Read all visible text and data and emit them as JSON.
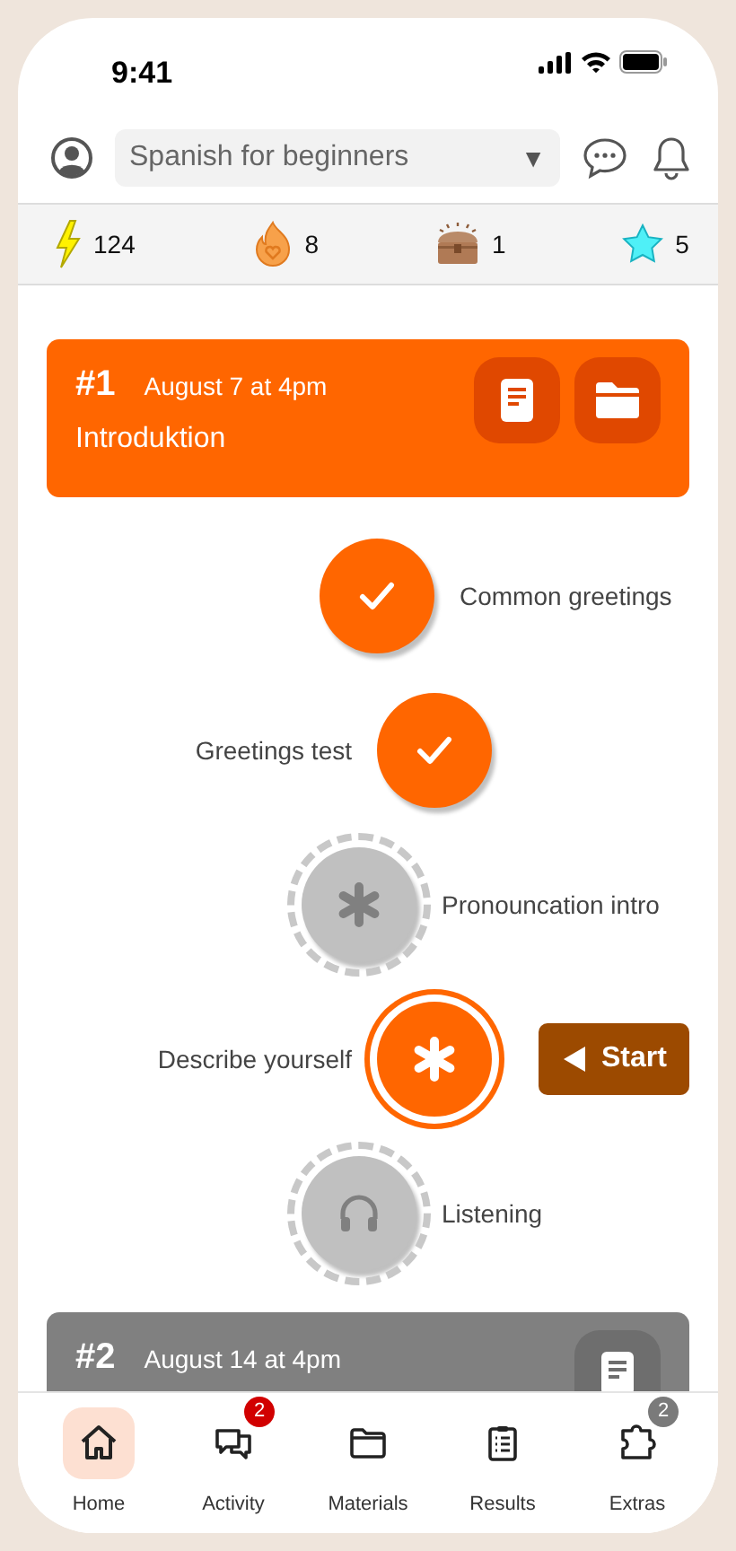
{
  "status_bar": {
    "time": "9:41"
  },
  "header": {
    "course_select": {
      "value": "Spanish for beginners",
      "caret": "▼"
    }
  },
  "stats": [
    {
      "value": "124"
    },
    {
      "value": "8"
    },
    {
      "value": "1"
    },
    {
      "value": "5"
    }
  ],
  "sessions": [
    {
      "number": "#1",
      "date": "August 7 at 4pm",
      "title": "Introduktion",
      "selected": true,
      "lessons": [
        {
          "label": "Common greetings",
          "kind": "check",
          "locked": false,
          "selected": false
        },
        {
          "label": "Greetings test",
          "kind": "check",
          "locked": false,
          "selected": false
        },
        {
          "label": "Pronouncation intro",
          "kind": "asterisk",
          "locked": true,
          "selected": false
        },
        {
          "label": "Describe yourself",
          "kind": "asterisk",
          "locked": false,
          "selected": true,
          "action": "Start"
        },
        {
          "label": "Listening",
          "kind": "headphones",
          "locked": true,
          "selected": false
        }
      ]
    },
    {
      "number": "#2",
      "date": "August 14 at 4pm",
      "selected": false
    }
  ],
  "bottom_nav": [
    {
      "label": "Home",
      "selected": true
    },
    {
      "label": "Activity",
      "selected": false,
      "badge": "2",
      "color": "#d10000"
    },
    {
      "label": "Materials",
      "selected": false
    },
    {
      "label": "Results",
      "selected": false
    },
    {
      "label": "Extras",
      "selected": false,
      "badge": "2",
      "color": "#7a7a7a"
    }
  ]
}
